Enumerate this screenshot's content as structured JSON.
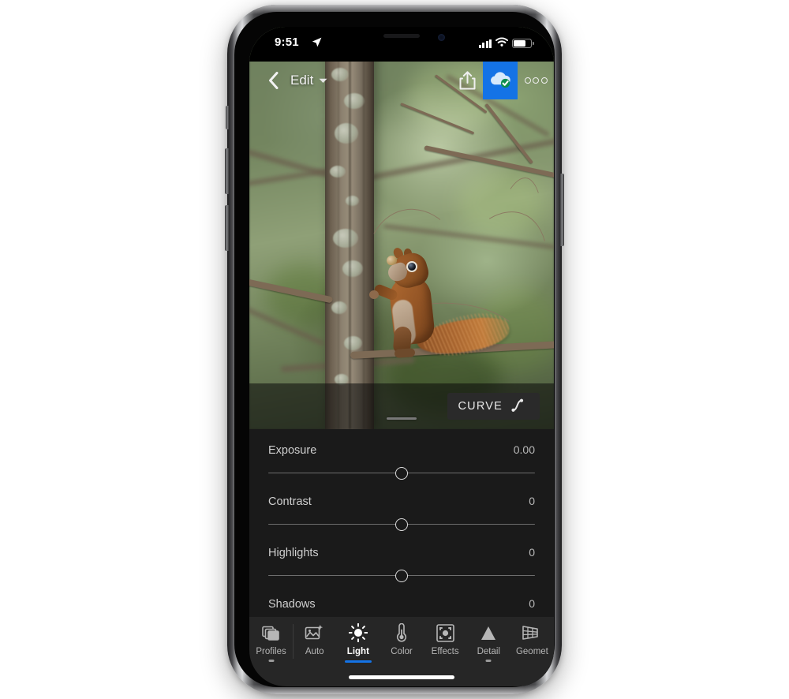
{
  "device": {
    "name": "smartphone-mockup",
    "status_bar": {
      "time": "9:51",
      "location_icon": "location-arrow-icon",
      "cellular_icon": "cellular-signal-icon",
      "wifi_icon": "wifi-icon",
      "battery_icon": "battery-icon"
    },
    "home_indicator": "home-indicator"
  },
  "app_bar": {
    "back_icon": "chevron-left-icon",
    "title": "Edit",
    "title_chevron_icon": "chevron-down-icon",
    "share_icon": "share-upload-icon",
    "sync_icon": "cloud-synced-icon",
    "more_icon": "more-options-icon",
    "sync_accent_color": "#1473e6"
  },
  "photo": {
    "name": "squirrel-on-tree-photo",
    "subject": "red squirrel climbing tree trunk",
    "drag_handle": "photo-resize-handle"
  },
  "curve": {
    "label": "CURVE",
    "icon": "tone-curve-icon"
  },
  "edit_panel": {
    "sliders": [
      {
        "label": "Exposure",
        "value": "0.00",
        "position": 50
      },
      {
        "label": "Contrast",
        "value": "0",
        "position": 50
      },
      {
        "label": "Highlights",
        "value": "0",
        "position": 50
      },
      {
        "label": "Shadows",
        "value": "0",
        "position": 50
      }
    ]
  },
  "tool_bar": {
    "accent_color": "#1473e6",
    "items": [
      {
        "label": "Profiles",
        "icon": "profiles-stack-icon",
        "active": false,
        "has_dot": true,
        "divider": false
      },
      {
        "label": "Auto",
        "icon": "auto-magic-icon",
        "active": false,
        "has_dot": false,
        "divider": true
      },
      {
        "label": "Light",
        "icon": "light-sun-icon",
        "active": true,
        "has_dot": false,
        "divider": false
      },
      {
        "label": "Color",
        "icon": "color-thermometer-icon",
        "active": false,
        "has_dot": false,
        "divider": false
      },
      {
        "label": "Effects",
        "icon": "effects-frame-icon",
        "active": false,
        "has_dot": false,
        "divider": false
      },
      {
        "label": "Detail",
        "icon": "detail-triangle-icon",
        "active": false,
        "has_dot": true,
        "divider": false
      },
      {
        "label": "Geomet",
        "icon": "geometry-grid-icon",
        "active": false,
        "has_dot": false,
        "divider": false
      }
    ]
  }
}
